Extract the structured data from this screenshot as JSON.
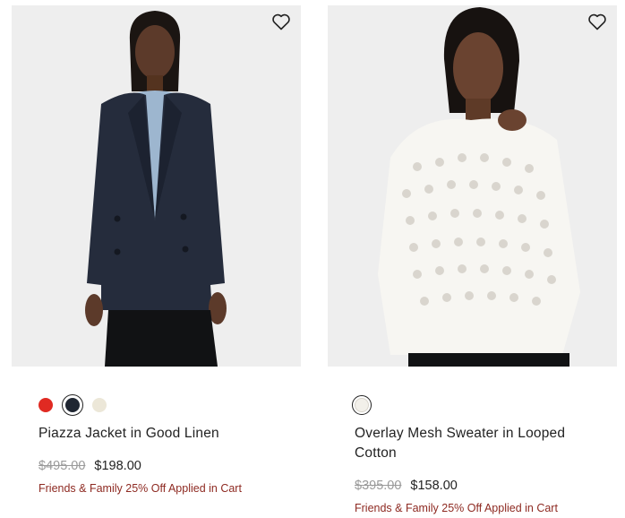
{
  "products": [
    {
      "name": "Piazza Jacket in Good Linen",
      "original_price": "$495.00",
      "sale_price": "$198.00",
      "promo": "Friends & Family 25% Off Applied in Cart",
      "image": "model wearing navy double-breasted blazer",
      "wishlist_icon": "heart-outline-icon",
      "swatches": [
        {
          "color": "#e02a22",
          "selected": false
        },
        {
          "color": "#1f2632",
          "selected": true
        },
        {
          "color": "#ece7d8",
          "selected": false
        }
      ]
    },
    {
      "name": "Overlay Mesh Sweater in Looped Cotton",
      "original_price": "$395.00",
      "sale_price": "$158.00",
      "promo": "Friends & Family 25% Off Applied in Cart",
      "image": "model wearing white open-knit sweater",
      "wishlist_icon": "heart-outline-icon",
      "swatches": [
        {
          "color": "#f2f0ea",
          "selected": true
        }
      ]
    }
  ]
}
